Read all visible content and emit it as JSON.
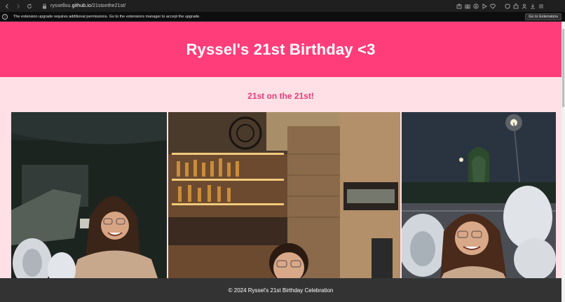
{
  "browser": {
    "url_host": "ryssellou.github.io",
    "url_path": "/21stonthe21st/",
    "url_prefix": "ryssellou.",
    "url_host_rest": "github.io",
    "toolbar_icons": [
      "share-icon",
      "camera-icon",
      "download-circle-icon",
      "play-icon",
      "heart-icon",
      "shield-icon",
      "extensions-icon",
      "profile-icon",
      "download-icon",
      "menu-icon"
    ]
  },
  "notification": {
    "text": "The extension upgrade requires additional permissions. Go to the extensions manager to accept the upgrade.",
    "button_label": "Go to Extensions"
  },
  "page": {
    "title": "Ryssel's 21st Birthday <3",
    "subtitle": "21st on the 21st!",
    "footer": "© 2024 Ryssel's 21st Birthday Celebration"
  },
  "photos": [
    {
      "name": "photo-car-night"
    },
    {
      "name": "photo-restaurant-bar"
    },
    {
      "name": "photo-parking-lot-night"
    }
  ],
  "colors": {
    "header": "#ff3d7a",
    "background": "#ffe0e6",
    "subtitle": "#e63b7a",
    "footer": "#333333"
  }
}
